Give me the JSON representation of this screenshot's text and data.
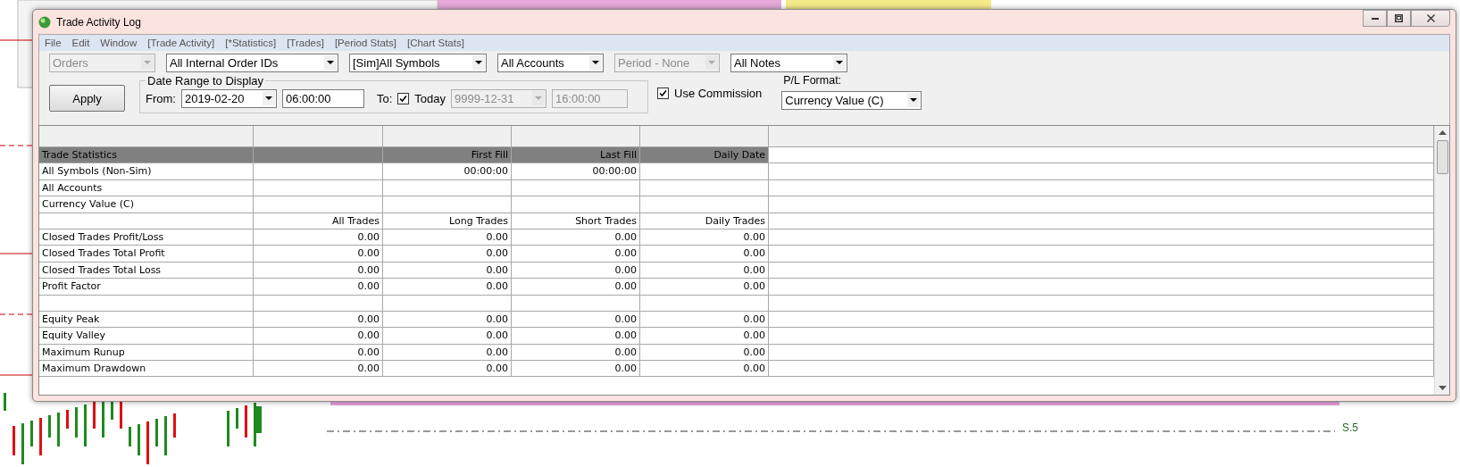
{
  "window": {
    "title": "Trade Activity Log"
  },
  "menu": [
    "File",
    "Edit",
    "Window",
    "[Trade Activity]",
    "[*Statistics]",
    "[Trades]",
    "[Period Stats]",
    "[Chart Stats]"
  ],
  "filters": [
    {
      "value": "Orders",
      "disabled": true
    },
    {
      "value": "All Internal Order IDs",
      "disabled": false
    },
    {
      "value": "[Sim]All Symbols",
      "disabled": false
    },
    {
      "value": "All Accounts",
      "disabled": false
    },
    {
      "value": "Period - None",
      "disabled": true
    },
    {
      "value": "All Notes",
      "disabled": false
    }
  ],
  "apply_button": "Apply",
  "date_range": {
    "title": "Date Range to Display",
    "from_label": "From:",
    "from_date": "2019-02-20",
    "from_time": "06:00:00",
    "to_label": "To:",
    "today": {
      "label": "Today",
      "checked": true
    },
    "to_date": {
      "value": "9999-12-31",
      "disabled": true
    },
    "to_time": {
      "value": "16:00:00",
      "disabled": true
    }
  },
  "use_commission": {
    "label": "Use Commission",
    "checked": true
  },
  "pl_format": {
    "label": "P/L Format:",
    "value": "Currency Value (C)"
  },
  "table": {
    "header": {
      "column_1": "Trade Statistics",
      "column_3": "First Fill",
      "column_4": "Last Fill",
      "column_5": "Daily Date"
    },
    "rows": [
      {
        "column_1": "All Symbols (Non-Sim)",
        "column_3": "00:00:00",
        "column_4": "00:00:00"
      },
      {
        "column_1": "All Accounts"
      },
      {
        "column_1": "Currency Value (C)"
      },
      {
        "column_2": "All Trades",
        "column_3": "Long Trades",
        "column_4": "Short Trades",
        "column_5": "Daily Trades"
      },
      {
        "column_1": "Closed Trades Profit/Loss",
        "column_2": "0.00",
        "column_3": "0.00",
        "column_4": "0.00",
        "column_5": "0.00"
      },
      {
        "column_1": "Closed Trades Total Profit",
        "column_2": "0.00",
        "column_3": "0.00",
        "column_4": "0.00",
        "column_5": "0.00"
      },
      {
        "column_1": "Closed Trades Total Loss",
        "column_2": "0.00",
        "column_3": "0.00",
        "column_4": "0.00",
        "column_5": "0.00"
      },
      {
        "column_1": "Profit Factor",
        "column_2": "0.00",
        "column_3": "0.00",
        "column_4": "0.00",
        "column_5": "0.00"
      },
      {},
      {
        "column_1": "Equity Peak",
        "column_2": "0.00",
        "column_3": "0.00",
        "column_4": "0.00",
        "column_5": "0.00"
      },
      {
        "column_1": "Equity Valley",
        "column_2": "0.00",
        "column_3": "0.00",
        "column_4": "0.00",
        "column_5": "0.00"
      },
      {
        "column_1": "Maximum Runup",
        "column_2": "0.00",
        "column_3": "0.00",
        "column_4": "0.00",
        "column_5": "0.00"
      },
      {
        "column_1": "Maximum Drawdown",
        "column_2": "0.00",
        "column_3": "0.00",
        "column_4": "0.00",
        "column_5": "0.00"
      }
    ]
  },
  "chart": {
    "level_label": "S.5"
  }
}
